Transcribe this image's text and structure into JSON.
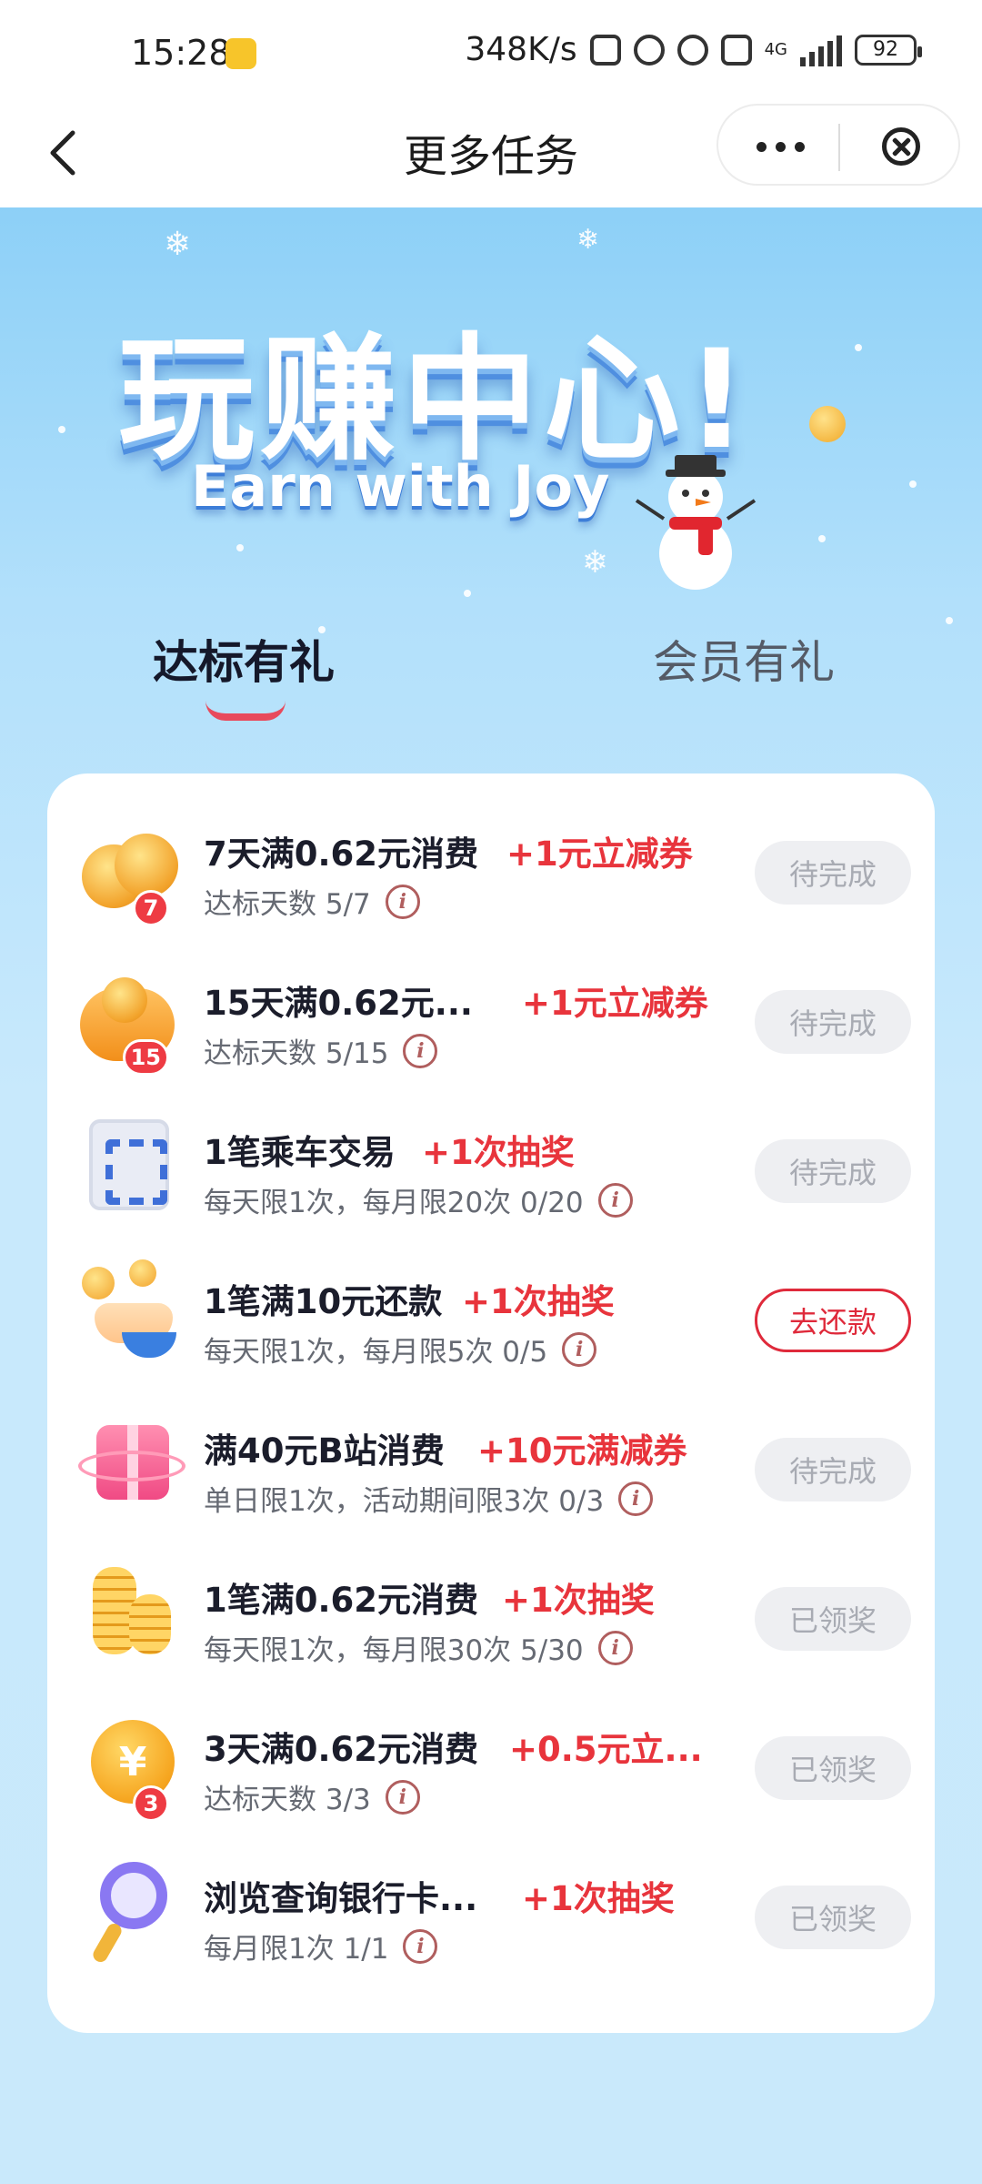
{
  "status_bar": {
    "time": "15:28",
    "network_speed": "348K/s",
    "signal_label": "4G",
    "battery": "92"
  },
  "nav": {
    "title": "更多任务"
  },
  "hero": {
    "title": "玩赚中心!",
    "subtitle": "Earn with Joy"
  },
  "tabs": [
    {
      "label": "达标有礼",
      "active": true
    },
    {
      "label": "会员有礼",
      "active": false
    }
  ],
  "tasks": [
    {
      "title": "7天满0.62元消费",
      "reward": "+1元立减券",
      "sub": "达标天数 5/7",
      "button": "待完成",
      "state": "pending",
      "icon": "coin-stack-icon",
      "badge": "7"
    },
    {
      "title": "15天满0.62元...",
      "reward": "+1元立减券",
      "sub": "达标天数 5/15",
      "button": "待完成",
      "state": "pending",
      "icon": "treasure-chest-icon",
      "badge": "15"
    },
    {
      "title": "1笔乘车交易",
      "reward": "+1次抽奖",
      "sub": "每天限1次，每月限20次 0/20",
      "button": "待完成",
      "state": "pending",
      "icon": "qr-code-icon"
    },
    {
      "title": "1笔满10元还款",
      "reward": "+1次抽奖",
      "sub": "每天限1次，每月限5次 0/5",
      "button": "去还款",
      "state": "action",
      "icon": "hand-coin-icon"
    },
    {
      "title": "满40元B站消费",
      "reward": "+10元满减券",
      "sub": "单日限1次，活动期间限3次 0/3",
      "button": "待完成",
      "state": "pending",
      "icon": "gift-box-icon"
    },
    {
      "title": "1笔满0.62元消费",
      "reward": "+1次抽奖",
      "sub": "每天限1次，每月限30次 5/30",
      "button": "已领奖",
      "state": "claimed",
      "icon": "coin-stacks-icon"
    },
    {
      "title": "3天满0.62元消费",
      "reward": "+0.5元立...",
      "sub": "达标天数 3/3",
      "button": "已领奖",
      "state": "claimed",
      "icon": "yuan-coin-icon",
      "badge": "3"
    },
    {
      "title": "浏览查询银行卡...",
      "reward": "+1次抽奖",
      "sub": "每月限1次 1/1",
      "button": "已领奖",
      "state": "claimed",
      "icon": "magnifier-icon"
    }
  ],
  "colors": {
    "accent_red": "#e8343c",
    "hero_blue": "#8dd0f7",
    "button_grey": "#eeeff2"
  }
}
